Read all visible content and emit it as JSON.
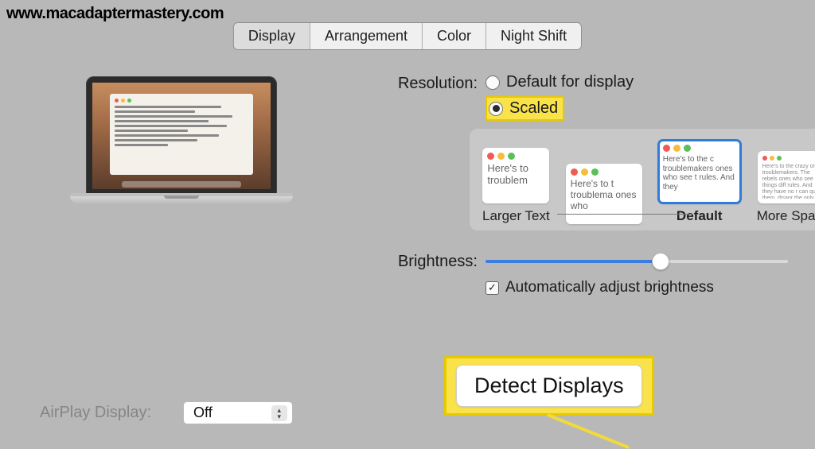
{
  "watermark": "www.macadaptermastery.com",
  "tabs": {
    "display": "Display",
    "arrangement": "Arrangement",
    "color": "Color",
    "night_shift": "Night Shift"
  },
  "resolution": {
    "label": "Resolution:",
    "default_opt": "Default for display",
    "scaled_opt": "Scaled"
  },
  "scale": {
    "larger": "Larger Text",
    "default": "Default",
    "more_space": "More Space",
    "sample1": "Here's to troublem",
    "sample2": "Here's to t troublema ones who",
    "sample3": "Here's to the c troublemakers ones who see t rules. And they",
    "sample4": "Here's to the crazy ones troublemakers. The rebels ones who see things diff rules. And they have no r can quote them, disagr the only th Because they change t"
  },
  "brightness": {
    "label": "Brightness:",
    "auto": "Automatically adjust brightness"
  },
  "detect_button": "Detect Displays",
  "bottom_select": "Off"
}
